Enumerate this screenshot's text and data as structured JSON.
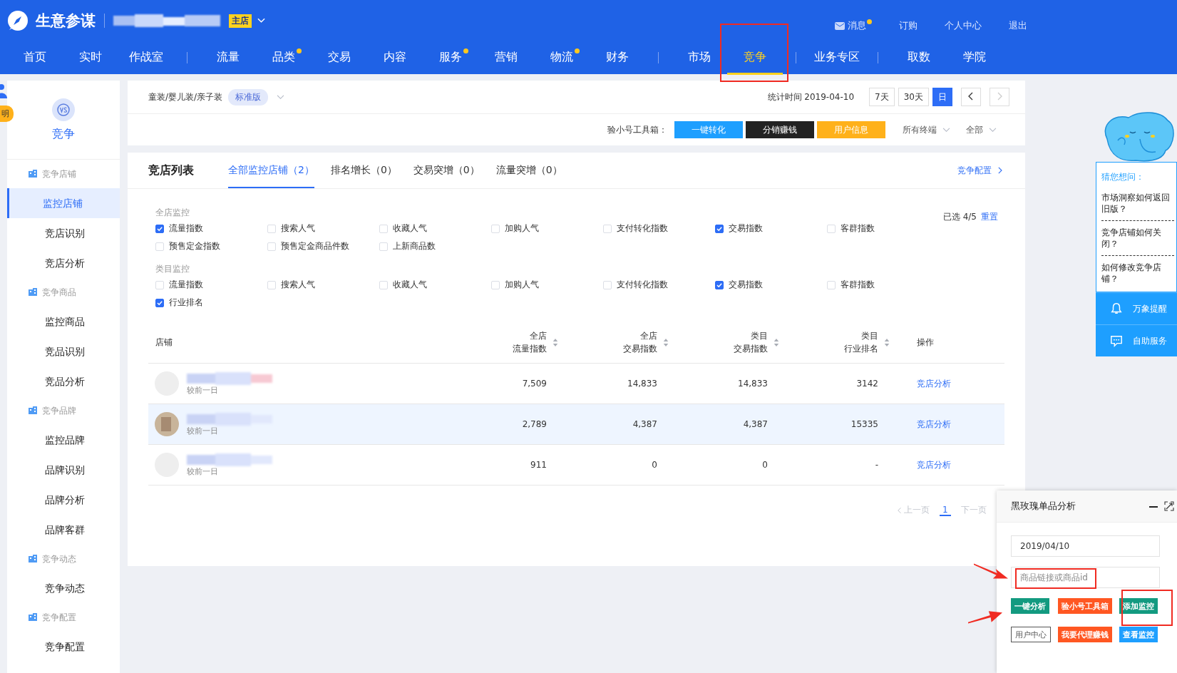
{
  "header": {
    "logo_text": "生意参谋",
    "shop_badge": "主店",
    "links": [
      {
        "label": "消息",
        "dot": true
      },
      {
        "label": "订购",
        "dot": false
      },
      {
        "label": "个人中心",
        "dot": false
      },
      {
        "label": "退出",
        "dot": false
      }
    ]
  },
  "nav": [
    {
      "label": "首页",
      "dot": false,
      "selected": false,
      "divider_before": false
    },
    {
      "label": "实时",
      "dot": false,
      "selected": false,
      "divider_before": false
    },
    {
      "label": "作战室",
      "dot": false,
      "selected": false,
      "divider_before": false
    },
    {
      "label": "流量",
      "dot": false,
      "selected": false,
      "divider_before": true
    },
    {
      "label": "品类",
      "dot": true,
      "selected": false,
      "divider_before": false
    },
    {
      "label": "交易",
      "dot": false,
      "selected": false,
      "divider_before": false
    },
    {
      "label": "内容",
      "dot": false,
      "selected": false,
      "divider_before": false
    },
    {
      "label": "服务",
      "dot": true,
      "selected": false,
      "divider_before": false
    },
    {
      "label": "营销",
      "dot": false,
      "selected": false,
      "divider_before": false
    },
    {
      "label": "物流",
      "dot": true,
      "selected": false,
      "divider_before": false
    },
    {
      "label": "财务",
      "dot": false,
      "selected": false,
      "divider_before": false
    },
    {
      "label": "市场",
      "dot": false,
      "selected": false,
      "divider_before": true
    },
    {
      "label": "竞争",
      "dot": false,
      "selected": true,
      "divider_before": false
    },
    {
      "label": "业务专区",
      "dot": false,
      "selected": false,
      "divider_before": true
    },
    {
      "label": "取数",
      "dot": false,
      "selected": false,
      "divider_before": true
    },
    {
      "label": "学院",
      "dot": false,
      "selected": false,
      "divider_before": false
    }
  ],
  "explain_tab": "明",
  "sidebar": {
    "title": "竞争",
    "groups": [
      {
        "label": "竞争店铺",
        "items": [
          {
            "label": "监控店铺",
            "selected": true
          },
          {
            "label": "竞店识别",
            "selected": false
          },
          {
            "label": "竞店分析",
            "selected": false
          }
        ]
      },
      {
        "label": "竞争商品",
        "items": [
          {
            "label": "监控商品",
            "selected": false
          },
          {
            "label": "竞品识别",
            "selected": false
          },
          {
            "label": "竞品分析",
            "selected": false
          }
        ]
      },
      {
        "label": "竞争品牌",
        "items": [
          {
            "label": "监控品牌",
            "selected": false
          },
          {
            "label": "品牌识别",
            "selected": false
          },
          {
            "label": "品牌分析",
            "selected": false
          },
          {
            "label": "品牌客群",
            "selected": false
          }
        ]
      },
      {
        "label": "竞争动态",
        "items": [
          {
            "label": "竞争动态",
            "selected": false
          }
        ]
      },
      {
        "label": "竞争配置",
        "items": [
          {
            "label": "竞争配置",
            "selected": false
          }
        ]
      }
    ]
  },
  "filter_bar": {
    "category": "童装/婴儿装/亲子装",
    "edition": "标准版",
    "stat_time": "统计时间 2019-04-10",
    "ranges": [
      {
        "label": "7天",
        "selected": false
      },
      {
        "label": "30天",
        "selected": false
      },
      {
        "label": "日",
        "selected": true
      }
    ],
    "toolbox_label": "验小号工具箱：",
    "tools": [
      {
        "label": "一键转化",
        "color": "#1e9fff"
      },
      {
        "label": "分销赚钱",
        "color": "#222222"
      },
      {
        "label": "用户信息",
        "color": "#ffb11a"
      }
    ],
    "dropdowns": [
      "所有终端",
      "全部"
    ]
  },
  "competitor_list": {
    "title": "竞店列表",
    "tabs": [
      {
        "label": "全部监控店铺（2）",
        "selected": true
      },
      {
        "label": "排名增长（0）",
        "selected": false
      },
      {
        "label": "交易突增（0）",
        "selected": false
      },
      {
        "label": "流量突增（0）",
        "selected": false
      }
    ],
    "config_link": "竞争配置",
    "selected_count": "已选 4/5",
    "reset": "重置",
    "groups": [
      {
        "label": "全店监控",
        "options": [
          {
            "label": "流量指数",
            "checked": true
          },
          {
            "label": "搜索人气",
            "checked": false
          },
          {
            "label": "收藏人气",
            "checked": false
          },
          {
            "label": "加购人气",
            "checked": false
          },
          {
            "label": "支付转化指数",
            "checked": false
          },
          {
            "label": "交易指数",
            "checked": true
          },
          {
            "label": "客群指数",
            "checked": false
          },
          {
            "label": "预售定金指数",
            "checked": false
          },
          {
            "label": "预售定金商品件数",
            "checked": false
          },
          {
            "label": "上新商品数",
            "checked": false
          }
        ]
      },
      {
        "label": "类目监控",
        "options": [
          {
            "label": "流量指数",
            "checked": false
          },
          {
            "label": "搜索人气",
            "checked": false
          },
          {
            "label": "收藏人气",
            "checked": false
          },
          {
            "label": "加购人气",
            "checked": false
          },
          {
            "label": "支付转化指数",
            "checked": false
          },
          {
            "label": "交易指数",
            "checked": true
          },
          {
            "label": "客群指数",
            "checked": false
          },
          {
            "label": "行业排名",
            "checked": true
          }
        ]
      }
    ],
    "table": {
      "columns": [
        {
          "bottom": "店铺",
          "sortable": false
        },
        {
          "top": "全店",
          "bottom": "流量指数",
          "sortable": true
        },
        {
          "top": "全店",
          "bottom": "交易指数",
          "sortable": true
        },
        {
          "top": "类目",
          "bottom": "交易指数",
          "sortable": true
        },
        {
          "top": "类目",
          "bottom": "行业排名",
          "sortable": true
        },
        {
          "bottom": "操作",
          "sortable": false
        }
      ],
      "rows": [
        {
          "cells": [
            "较前一日",
            "7,509",
            "14,833",
            "14,833",
            "3142",
            "竞店分析"
          ],
          "highlighted": false
        },
        {
          "cells": [
            "较前一日",
            "2,789",
            "4,387",
            "4,387",
            "15335",
            "竞店分析"
          ],
          "highlighted": true
        },
        {
          "cells": [
            "较前一日",
            "911",
            "0",
            "0",
            "-",
            "竞店分析"
          ],
          "highlighted": false
        }
      ]
    },
    "pagination": {
      "prev": "上一页",
      "page": "1",
      "next": "下一页"
    }
  },
  "help_panel": {
    "title": "猜您想问：",
    "questions": [
      "市场洞察如何返回旧版？",
      "竞争店铺如何关闭？",
      "如何修改竞争店铺？"
    ],
    "actions": [
      "万象提醒",
      "自助服务"
    ]
  },
  "popup": {
    "title": "黑玫瑰单品分析",
    "date": "2019/04/10",
    "placeholder": "商品链接或商品id",
    "buttons": [
      {
        "label": "一键分析",
        "kind": "solid",
        "color": "#139a80"
      },
      {
        "label": "验小号工具箱",
        "kind": "solid",
        "color": "#ff5722"
      },
      {
        "label": "添加监控",
        "kind": "solid",
        "color": "#139a80"
      },
      {
        "label": "用户中心",
        "kind": "outline",
        "color": "#555555"
      },
      {
        "label": "我要代理赚钱",
        "kind": "solid",
        "color": "#ff5722"
      },
      {
        "label": "查看监控",
        "kind": "solid",
        "color": "#1e9fff"
      }
    ]
  }
}
